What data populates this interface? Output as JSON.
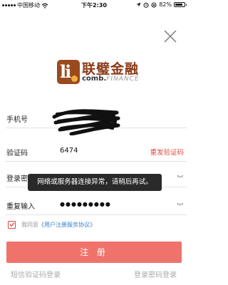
{
  "status_bar": {
    "carrier": "中国移动",
    "time": "下午2:30",
    "battery": "82%",
    "battery_level": 0.82
  },
  "logo": {
    "name_cn": "联璧金融",
    "name_en_bold": "comb.",
    "name_en_light": "FINANCE",
    "mark": "li"
  },
  "form": {
    "phone": {
      "label": "手机号",
      "value": ""
    },
    "code": {
      "label": "验证码",
      "value": "6474",
      "action": "重发验证码"
    },
    "password": {
      "label": "登录密码"
    },
    "confirm": {
      "label": "重复输入",
      "value": "●●●●●●●●●"
    }
  },
  "toast": "网络或服务器连接异常，请稍后再试。",
  "agreement": {
    "checked": true,
    "prefix": "我同意",
    "link": "《用户注册服务协议》"
  },
  "register_button": "注 册",
  "links": {
    "sms_login": "短信验证码登录",
    "password_login": "登录密码登录"
  },
  "colors": {
    "accent": "#e0463e",
    "button": "#f0736b",
    "link": "#3b82c4",
    "brand": "#8a3a18"
  }
}
